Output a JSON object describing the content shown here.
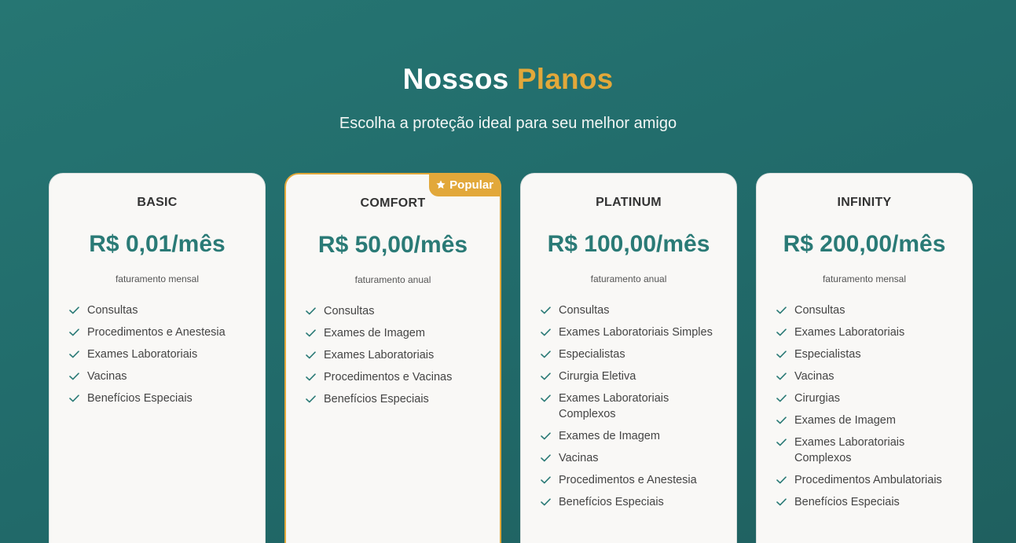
{
  "header": {
    "title_part1": "Nossos",
    "title_part2": "Planos",
    "subtitle": "Escolha a proteção ideal para seu melhor amigo"
  },
  "colors": {
    "accent": "#e2a83a",
    "primary": "#2a7a76",
    "background": "#226c6a",
    "card": "#f9f8f6"
  },
  "plans": [
    {
      "name": "BASIC",
      "price": "R$ 0,01/mês",
      "billing": "faturamento mensal",
      "featured": false,
      "features": [
        "Consultas",
        "Procedimentos e Anestesia",
        "Exames Laboratoriais",
        "Vacinas",
        "Benefícios Especiais"
      ]
    },
    {
      "name": "COMFORT",
      "price": "R$ 50,00/mês",
      "billing": "faturamento anual",
      "featured": true,
      "badge": {
        "label": "Popular",
        "icon": "star-icon"
      },
      "features": [
        "Consultas",
        "Exames de Imagem",
        "Exames Laboratoriais",
        "Procedimentos e Vacinas",
        "Benefícios Especiais"
      ]
    },
    {
      "name": "PLATINUM",
      "price": "R$ 100,00/mês",
      "billing": "faturamento anual",
      "featured": false,
      "features": [
        "Consultas",
        "Exames Laboratoriais Simples",
        "Especialistas",
        "Cirurgia Eletiva",
        "Exames Laboratoriais Complexos",
        "Exames de Imagem",
        "Vacinas",
        "Procedimentos e Anestesia",
        "Benefícios Especiais"
      ]
    },
    {
      "name": "INFINITY",
      "price": "R$ 200,00/mês",
      "billing": "faturamento mensal",
      "featured": false,
      "features": [
        "Consultas",
        "Exames Laboratoriais",
        "Especialistas",
        "Vacinas",
        "Cirurgias",
        "Exames de Imagem",
        "Exames Laboratoriais Complexos",
        "Procedimentos Ambulatoriais",
        "Benefícios Especiais"
      ]
    }
  ]
}
